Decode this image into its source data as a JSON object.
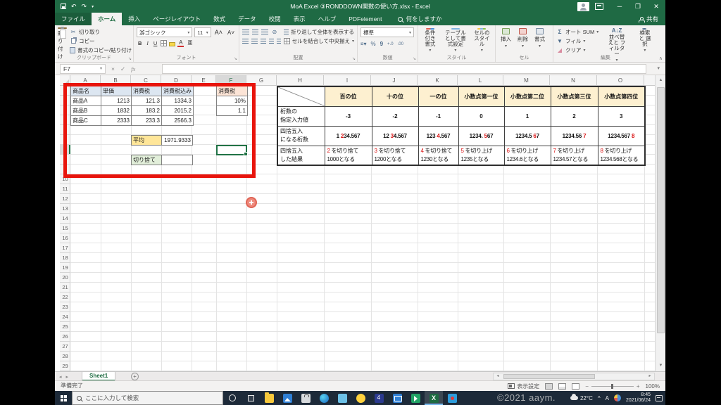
{
  "window": {
    "title": "MoA Excel ③RONDDOWN関数の使い方.xlsx  -  Excel",
    "share_label": "共有",
    "tellme_label": "何をしますか"
  },
  "menu_tabs": [
    "ファイル",
    "ホーム",
    "挿入",
    "ページレイアウト",
    "数式",
    "データ",
    "校閲",
    "表示",
    "ヘルプ",
    "PDFelement"
  ],
  "ribbon": {
    "paste": "貼り付け",
    "cut": "切り取り",
    "copy": "コピー",
    "format_painter": "書式のコピー/貼り付け",
    "clipboard_group": "クリップボード",
    "font_name": "游ゴシック",
    "font_size": "11",
    "font_group": "フォント",
    "wrap_text": "折り返して全体を表示する",
    "merge_center": "セルを結合して中央揃え",
    "align_group": "配置",
    "number_format": "標準",
    "number_group": "数値",
    "cond_format": "条件付き書式",
    "table_format": "テーブルとして書式設定",
    "cell_styles": "セルのスタイル",
    "styles_group": "スタイル",
    "insert": "挿入",
    "delete": "削除",
    "format": "書式",
    "cells_group": "セル",
    "autosum": "オート SUM",
    "fill": "フィル",
    "clear": "クリア",
    "sort_filter": "並べ替えと フィルター",
    "find_select": "検索と 選択",
    "edit_group": "編集"
  },
  "formula_bar": {
    "name_box": "F7",
    "formula": ""
  },
  "grid": {
    "columns": [
      "A",
      "B",
      "C",
      "D",
      "E",
      "F",
      "G",
      "H",
      "I",
      "J",
      "K",
      "L",
      "M",
      "N",
      "O"
    ],
    "row_count": 29,
    "selected_col": "F",
    "selected_row": 7
  },
  "product_table": {
    "headers": [
      "商品名",
      "単価",
      "消費税",
      "消費税込み"
    ],
    "rows": [
      [
        "商品A",
        "1213",
        "121.3",
        "1334.3"
      ],
      [
        "商品B",
        "1832",
        "183.2",
        "2015.2"
      ],
      [
        "商品C",
        "2333",
        "233.3",
        "2566.3"
      ]
    ],
    "tax_header": "消費税",
    "tax_rate": "10%",
    "tax_multiplier": "1.1",
    "average_label": "平均",
    "average_value": "1971.9333",
    "rounddown_label": "切り捨て"
  },
  "round_table": {
    "row_labels": [
      {
        "l1": "桁数の",
        "l2": "指定入力値"
      },
      {
        "l1": "四捨五入",
        "l2": "になる桁数"
      },
      {
        "l1": "四捨五入",
        "l2": "した結果"
      }
    ],
    "columns": [
      {
        "header": "百の位",
        "digit": "-3",
        "num_pre": "1 ",
        "num_red": "2",
        "num_post": "34.567",
        "res1_red": "2",
        "res1_rest": " を切り捨て",
        "res2": "1000となる"
      },
      {
        "header": "十の位",
        "digit": "-2",
        "num_pre": "12 ",
        "num_red": "3",
        "num_post": "4.567",
        "res1_red": "3",
        "res1_rest": " を切り捨て",
        "res2": "1200となる"
      },
      {
        "header": "一の位",
        "digit": "-1",
        "num_pre": "123 ",
        "num_red": "4",
        "num_post": ".567",
        "res1_red": "4",
        "res1_rest": " を切り捨て",
        "res2": "1230となる"
      },
      {
        "header": "小数点第一位",
        "digit": "0",
        "num_pre": "1234. ",
        "num_red": "5",
        "num_post": "67",
        "res1_red": "5",
        "res1_rest": " を切り上げ",
        "res2": "1235となる"
      },
      {
        "header": "小数点第二位",
        "digit": "1",
        "num_pre": "1234.5 ",
        "num_red": "6",
        "num_post": "7",
        "res1_red": "6",
        "res1_rest": " を切り上げ",
        "res2": "1234.6となる"
      },
      {
        "header": "小数点第三位",
        "digit": "2",
        "num_pre": "1234.56 ",
        "num_red": "7",
        "num_post": "",
        "res1_red": "7",
        "res1_rest": " を切り上げ",
        "res2": "1234.57となる"
      },
      {
        "header": "小数点第四位",
        "digit": "3",
        "num_pre": "1234.567 ",
        "num_red": "8",
        "num_post": "",
        "res1_red": "8",
        "res1_rest": " を切り上げ",
        "res2": "1234.568となる"
      }
    ]
  },
  "sheet_bar": {
    "tab": "Sheet1"
  },
  "status_bar": {
    "ready": "準備完了",
    "display_settings": "表示設定",
    "zoom": "100%"
  },
  "taskbar": {
    "search_placeholder": "ここに入力して検索",
    "weather": "22°C",
    "ime": "A",
    "time": "8:45",
    "date": "2021/06/24"
  },
  "watermark": "©2021 aaym.",
  "icons": {
    "scissors": "✂",
    "undo": "↶",
    "redo": "↷",
    "sum": "Σ",
    "bold": "B",
    "italic": "I",
    "underline": "U",
    "dropdown": "▾",
    "check": "✓",
    "cross": "×",
    "fx": "fx",
    "up_arrow": "▲",
    "down_arrow": "▼",
    "left_arrow": "◂",
    "right_arrow": "▸",
    "percent": "%",
    "comma": ",",
    "collapse": "∧",
    "chevron_up": "^"
  },
  "colors": {
    "excel_green": "#1f6a44",
    "selection_green": "#217346",
    "ribbon_bg": "#f3f2f1",
    "red_annotation": "#e8140c",
    "red_digit": "#d91111",
    "blue_header": "#dce6f1",
    "salmon_header": "#fce4d6",
    "gold_cell": "#ffe699",
    "green_cell": "#e2efda",
    "cream_header": "#fdf0d0",
    "taskbar_bg": "#1d2a39"
  }
}
